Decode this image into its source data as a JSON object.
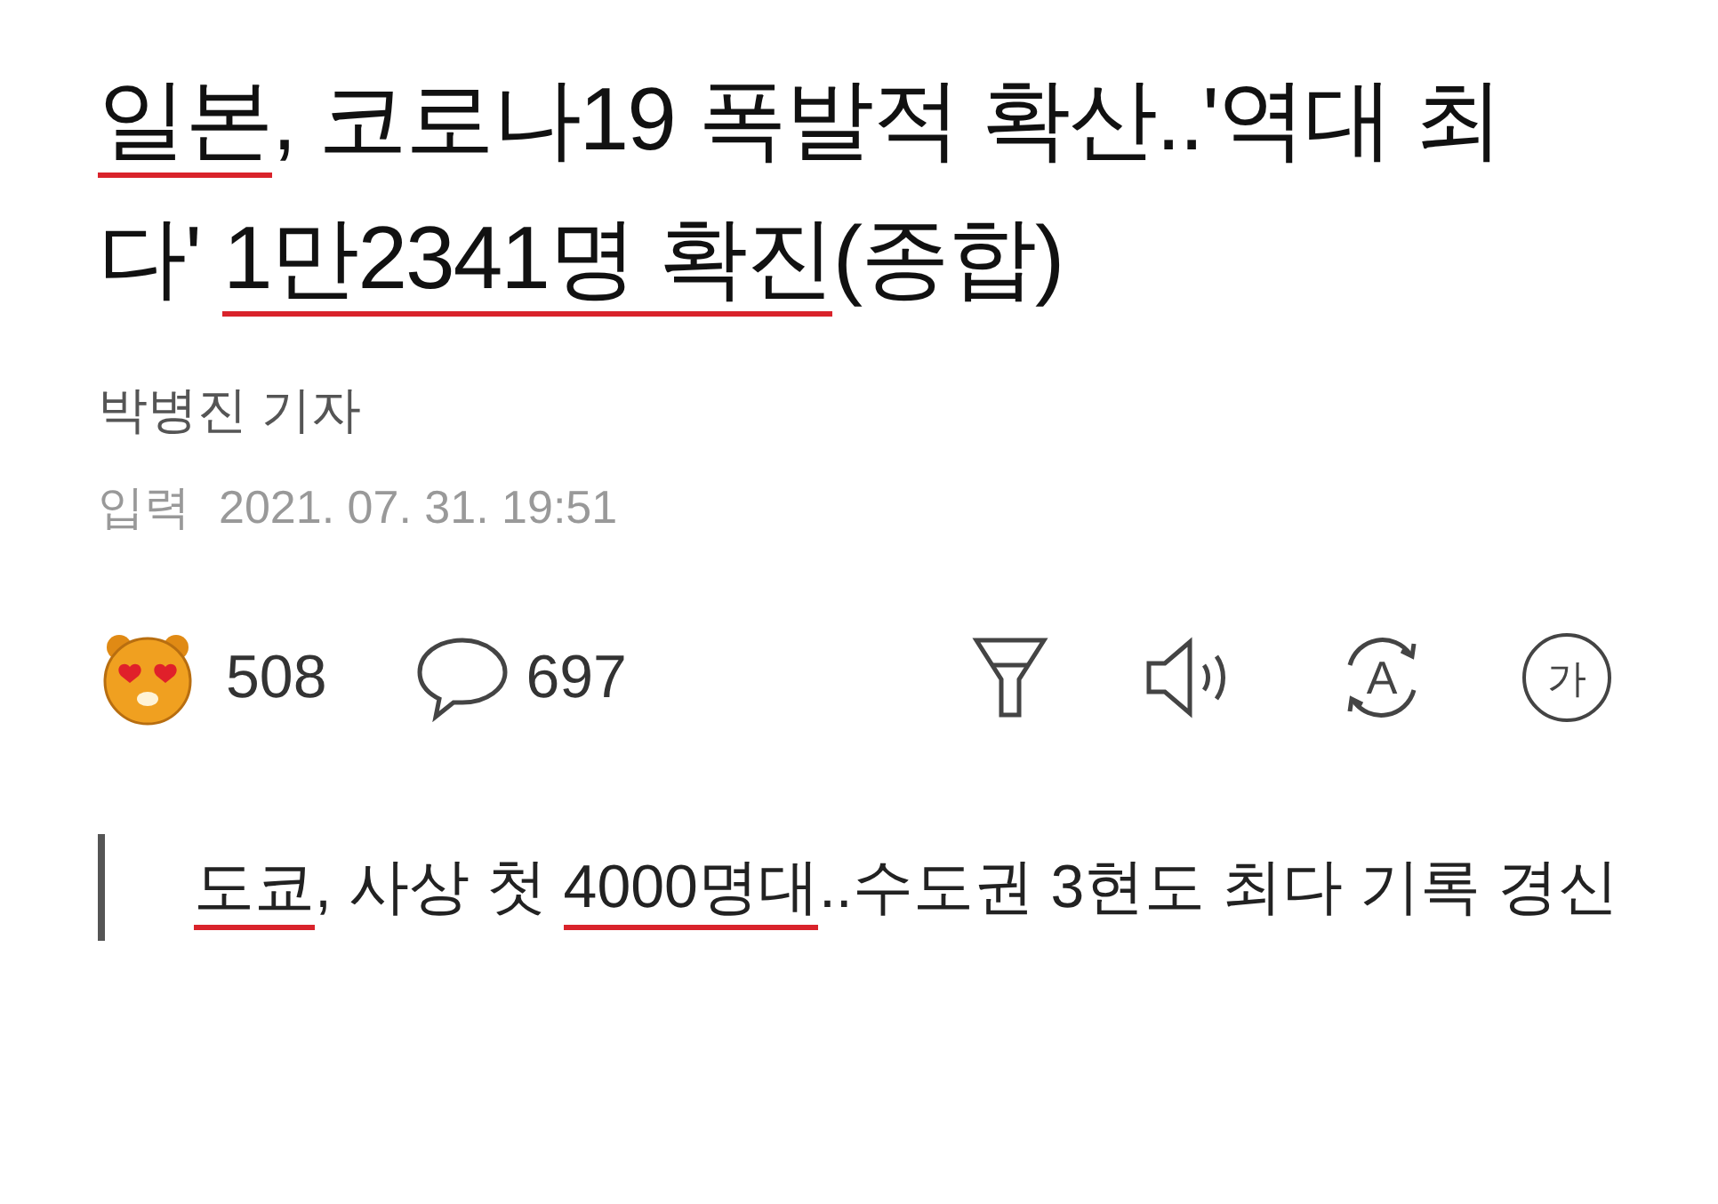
{
  "headline": [
    {
      "text": "일본",
      "underlined": true
    },
    {
      "text": ", 코로나19 폭발적 확산..'역대 최다' ",
      "underlined": false
    },
    {
      "text": "1만2341명 확진",
      "underlined": true
    },
    {
      "text": "(종합)",
      "underlined": false
    }
  ],
  "reporter": "박병진 기자",
  "published": {
    "label": "입력",
    "value": "2021. 07. 31. 19:51"
  },
  "reactions": {
    "count": "508"
  },
  "comments": {
    "count": "697"
  },
  "tools": [
    {
      "kind": "summary"
    },
    {
      "kind": "listen"
    },
    {
      "kind": "translate",
      "label": "A"
    },
    {
      "kind": "font",
      "label": "가"
    }
  ],
  "subtitle": [
    {
      "text": "도쿄",
      "underlined": true
    },
    {
      "text": ", 사상 첫 ",
      "underlined": false
    },
    {
      "text": "4000명대",
      "underlined": true
    },
    {
      "text": "..수도권 3현도 최다 기록 경신",
      "underlined": false
    }
  ]
}
